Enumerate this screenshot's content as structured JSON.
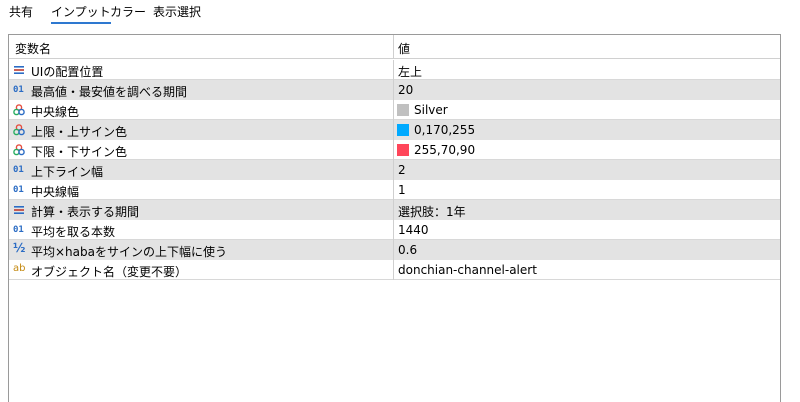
{
  "tabs": [
    {
      "label": "共有",
      "active": false
    },
    {
      "label": "インプット",
      "active": true
    },
    {
      "label": "カラー",
      "active": false
    },
    {
      "label": "表示選択",
      "active": false
    }
  ],
  "table": {
    "headers": {
      "name": "変数名",
      "value": "値"
    },
    "rows": [
      {
        "icon": "enum-icon",
        "name": "UIの配置位置",
        "value": "左上"
      },
      {
        "icon": "number-icon",
        "name": "最高値・最安値を調べる期間",
        "value": "20"
      },
      {
        "icon": "color-icon",
        "name": "中央線色",
        "value": "Silver",
        "swatch": "#c0c0c0"
      },
      {
        "icon": "color-icon",
        "name": "上限・上サイン色",
        "value": "0,170,255",
        "swatch": "#00aaff"
      },
      {
        "icon": "color-icon",
        "name": "下限・下サイン色",
        "value": "255,70,90",
        "swatch": "#ff465a"
      },
      {
        "icon": "number-icon",
        "name": "上下ライン幅",
        "value": "2"
      },
      {
        "icon": "number-icon",
        "name": "中央線幅",
        "value": "1"
      },
      {
        "icon": "enum-icon",
        "name": "計算・表示する期間",
        "value": "選択肢：1年"
      },
      {
        "icon": "number-icon",
        "name": "平均を取る本数",
        "value": "1440"
      },
      {
        "icon": "fraction-icon",
        "name": "平均×habaをサインの上下幅に使う",
        "value": "0.6"
      },
      {
        "icon": "string-icon",
        "name": "オブジェクト名（変更不要）",
        "value": "donchian-channel-alert"
      }
    ]
  },
  "icons": {
    "number": "01",
    "string": "ab",
    "fraction": "½"
  },
  "colors": {
    "accent": "#2e78d0"
  }
}
